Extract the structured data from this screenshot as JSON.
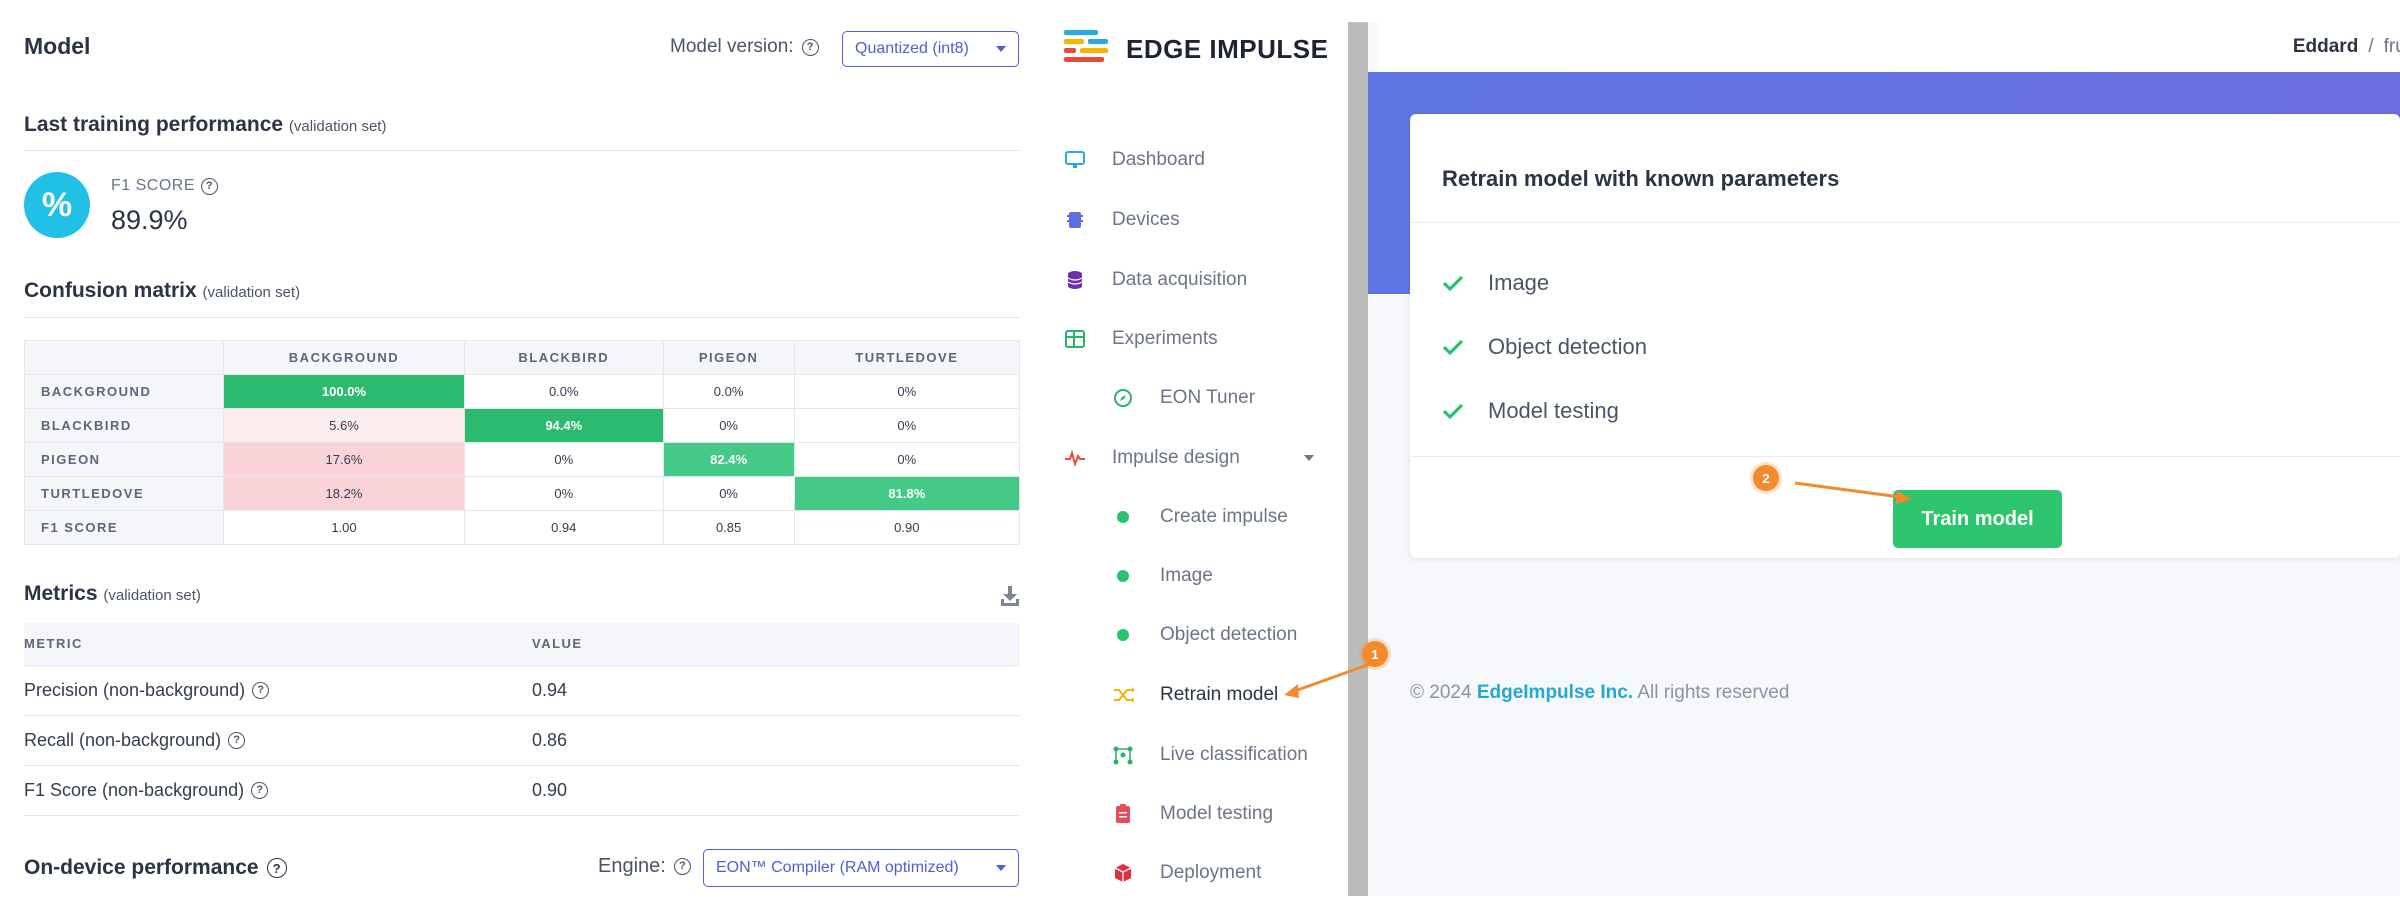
{
  "left": {
    "title": "Model",
    "model_version_label": "Model version:",
    "model_version_value": "Quantized (int8)",
    "training_title": "Last training performance",
    "training_note": "(validation set)",
    "f1_label": "F1 SCORE",
    "f1_value": "89.9%",
    "f1_icon_glyph": "%",
    "confusion_title": "Confusion matrix",
    "confusion_note": "(validation set)",
    "confusion_matrix": {
      "columns": [
        "BACKGROUND",
        "BLACKBIRD",
        "PIGEON",
        "TURTLEDOVE"
      ],
      "rows": [
        {
          "label": "BACKGROUND",
          "cells": [
            "100.0%",
            "0.0%",
            "0.0%",
            "0%"
          ]
        },
        {
          "label": "BLACKBIRD",
          "cells": [
            "5.6%",
            "94.4%",
            "0%",
            "0%"
          ]
        },
        {
          "label": "PIGEON",
          "cells": [
            "17.6%",
            "0%",
            "82.4%",
            "0%"
          ]
        },
        {
          "label": "TURTLEDOVE",
          "cells": [
            "18.2%",
            "0%",
            "0%",
            "81.8%"
          ]
        },
        {
          "label": "F1 SCORE",
          "cells": [
            "1.00",
            "0.94",
            "0.85",
            "0.90"
          ]
        }
      ]
    },
    "metrics_title": "Metrics",
    "metrics_note": "(validation set)",
    "metrics_headers": [
      "METRIC",
      "VALUE"
    ],
    "metrics": [
      {
        "name": "Precision (non-background)",
        "value": "0.94"
      },
      {
        "name": "Recall (non-background)",
        "value": "0.86"
      },
      {
        "name": "F1 Score (non-background)",
        "value": "0.90"
      }
    ],
    "ondevice_title": "On-device performance",
    "engine_label": "Engine:",
    "engine_value": "EON™ Compiler (RAM optimized)"
  },
  "right": {
    "brand": "EDGE IMPULSE",
    "breadcrumb": {
      "user": "Eddard",
      "sep": "/",
      "project": "frui"
    },
    "nav": [
      {
        "label": "Dashboard",
        "icon": "monitor-icon"
      },
      {
        "label": "Devices",
        "icon": "chip-icon"
      },
      {
        "label": "Data acquisition",
        "icon": "database-icon"
      },
      {
        "label": "Experiments",
        "icon": "table-icon"
      },
      {
        "label": "EON Tuner",
        "icon": "compass-icon"
      },
      {
        "label": "Impulse design",
        "icon": "pulse-icon"
      },
      {
        "label": "Create impulse",
        "icon": "dot-icon"
      },
      {
        "label": "Image",
        "icon": "dot-icon"
      },
      {
        "label": "Object detection",
        "icon": "dot-icon"
      },
      {
        "label": "Retrain model",
        "icon": "shuffle-icon"
      },
      {
        "label": "Live classification",
        "icon": "network-icon"
      },
      {
        "label": "Model testing",
        "icon": "clipboard-icon"
      },
      {
        "label": "Deployment",
        "icon": "cube-icon"
      }
    ],
    "card_title": "Retrain model with known parameters",
    "checks": [
      "Image",
      "Object detection",
      "Model testing"
    ],
    "train_button": "Train model",
    "footer_year": "© 2024",
    "footer_company": "EdgeImpulse Inc.",
    "footer_rights": "All rights reserved",
    "badge_1": "1",
    "badge_2": "2",
    "colors": {
      "accent": "#4c5fd5",
      "green": "#2cc46c",
      "cyan": "#21c1e7",
      "orange": "#f28a2e",
      "banner": "#5e76e3"
    }
  }
}
